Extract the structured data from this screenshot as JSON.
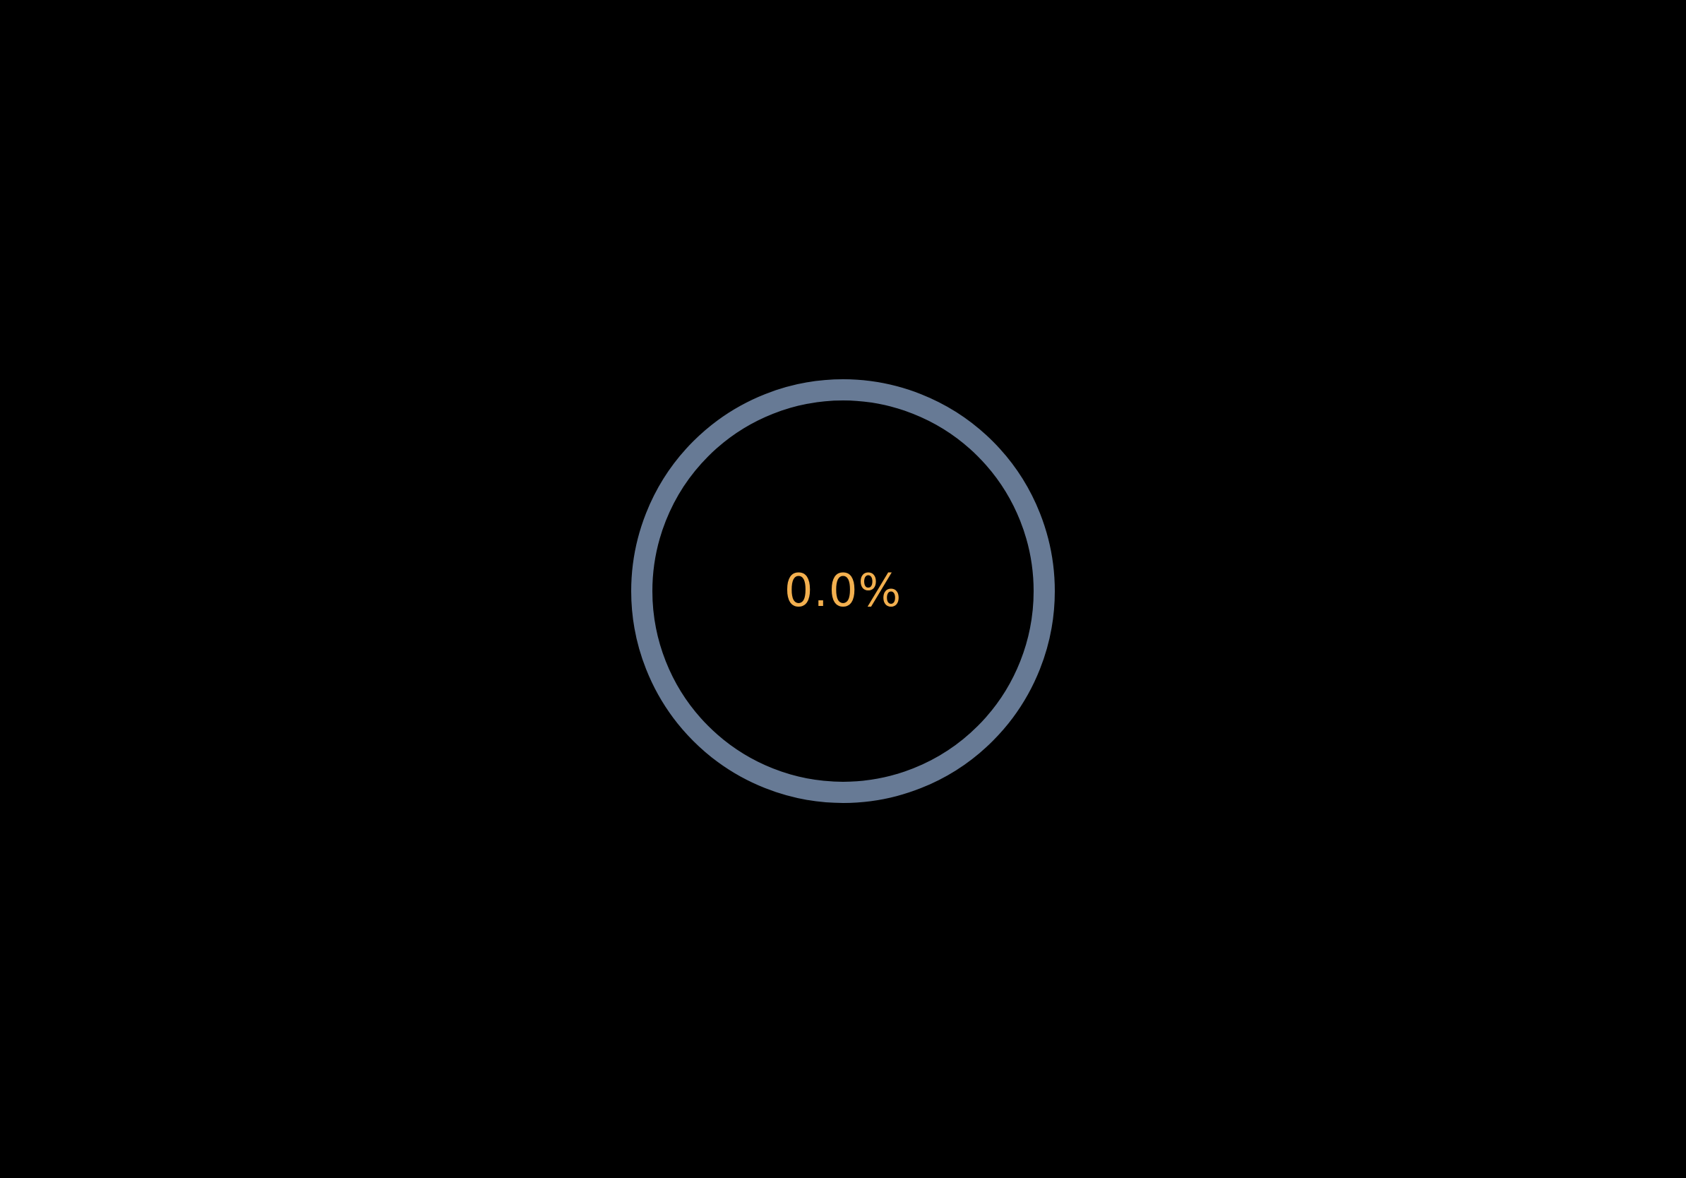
{
  "progress": {
    "value": 0.0,
    "label": "0.0%",
    "track_color": "#677a95",
    "fill_color": "#f3b04f",
    "text_color": "#f3b04f"
  },
  "background_color": "#000000"
}
